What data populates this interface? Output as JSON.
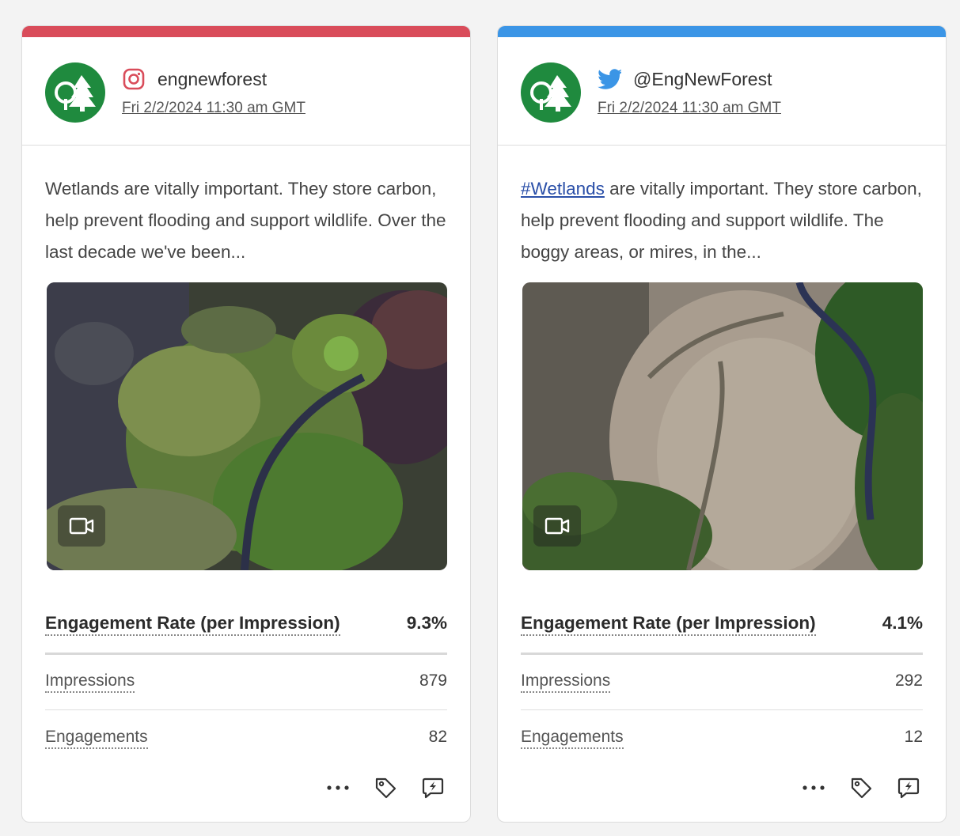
{
  "cards": [
    {
      "network": "instagram",
      "network_icon": "instagram-icon",
      "accent_color": "#d94c5a",
      "handle": "engnewforest",
      "timestamp": "Fri 2/2/2024 11:30 am GMT",
      "text": "Wetlands are vitally important. They store carbon, help prevent flooding and support wildlife. Over the last decade we've been...",
      "media": {
        "type": "video",
        "icon": "video-icon",
        "description_color": "#4a5a32"
      },
      "engagement_rate": {
        "label": "Engagement Rate (per Impression)",
        "value": "9.3%"
      },
      "impressions": {
        "label": "Impressions",
        "value": "879"
      },
      "engagements": {
        "label": "Engagements",
        "value": "82"
      },
      "actions": [
        "more-options-icon",
        "tag-icon",
        "boost-icon"
      ]
    },
    {
      "network": "twitter",
      "network_icon": "twitter-bird-icon",
      "accent_color": "#3b95e6",
      "handle": "@EngNewForest",
      "timestamp": "Fri 2/2/2024 11:30 am GMT",
      "hashtag": "#Wetlands",
      "text_rest": " are vitally important. They store carbon, help prevent flooding and support wildlife. The boggy areas, or mires, in the...",
      "media": {
        "type": "video",
        "icon": "video-icon",
        "description_color": "#8a7f6e"
      },
      "engagement_rate": {
        "label": "Engagement Rate (per Impression)",
        "value": "4.1%"
      },
      "impressions": {
        "label": "Impressions",
        "value": "292"
      },
      "engagements": {
        "label": "Engagements",
        "value": "12"
      },
      "actions": [
        "more-options-icon",
        "tag-icon",
        "boost-icon"
      ]
    }
  ],
  "colors": {
    "avatar_green": "#1f8a3e",
    "instagram_accent": "#d94c5a",
    "twitter_accent": "#3b95e6",
    "hashtag_link": "#2a4fa8"
  }
}
